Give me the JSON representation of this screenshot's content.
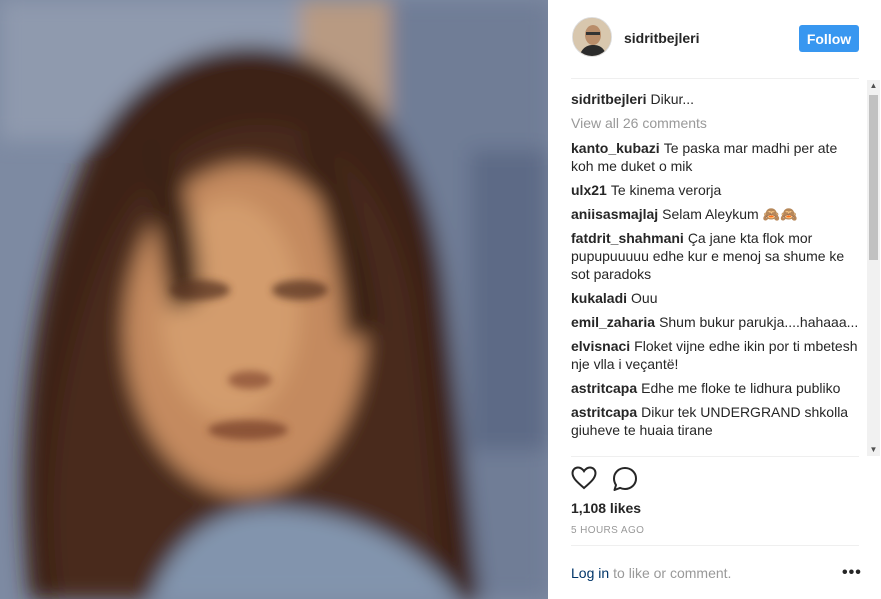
{
  "post": {
    "username": "sidritbejleri",
    "follow_label": "Follow",
    "caption_user": "sidritbejleri",
    "caption_text": "Dikur...",
    "view_all_label": "View all 26 comments",
    "likes": "1,108 likes",
    "time": "5 HOURS AGO",
    "login_label": "Log in",
    "login_suffix": "to like or comment.",
    "more_label": "•••"
  },
  "comments": [
    {
      "user": "kanto_kubazi",
      "text": "Te paska mar madhi per ate koh me duket o mik"
    },
    {
      "user": "ulx21",
      "text": "Te kinema verorja"
    },
    {
      "user": "aniisasmajlaj",
      "text": "Selam Aleykum 🙈🙈"
    },
    {
      "user": "fatdrit_shahmani",
      "text": "Ça jane kta flok mor pupupuuuuu edhe kur e menoj sa shume ke sot paradoks"
    },
    {
      "user": "kukaladi",
      "text": "Ouu"
    },
    {
      "user": "emil_zaharia",
      "text": "Shum bukur parukja....hahaaa..."
    },
    {
      "user": "elvisnaci",
      "text": "Floket vijne edhe ikin por ti mbetesh nje vlla i veçantë!"
    },
    {
      "user": "astritcapa",
      "text": "Edhe me floke te lidhura publiko"
    },
    {
      "user": "astritcapa",
      "text": "Dikur tek UNDERGRAND shkolla giuheve te huaia tirane"
    }
  ],
  "icons": {
    "like": "heart-icon",
    "comment": "comment-icon",
    "more": "more-options-icon"
  },
  "colors": {
    "follow_bg": "#3897f0",
    "login": "#003569",
    "muted": "#999999"
  }
}
